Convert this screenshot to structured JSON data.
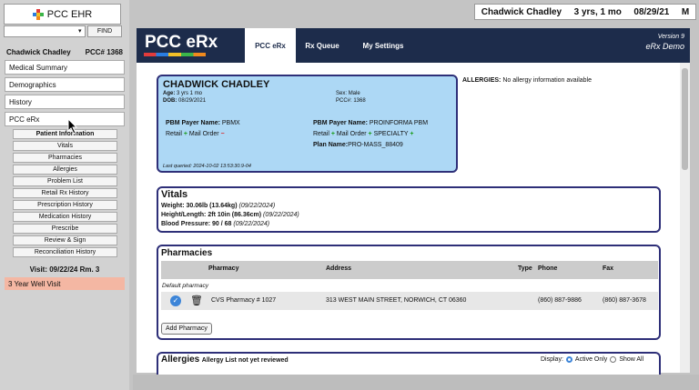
{
  "app": {
    "logo_text": "PCC EHR",
    "find_label": "FIND"
  },
  "patient_header": {
    "name": "Chadwick Chadley",
    "pcc": "PCC# 1368"
  },
  "top_header": {
    "name": "Chadwick Chadley",
    "age": "3 yrs, 1 mo",
    "dob": "08/29/21",
    "sex": "M"
  },
  "left_menu": [
    "Medical Summary",
    "Demographics",
    "History",
    "PCC eRx"
  ],
  "sub_menu": [
    "Patient Information",
    "Vitals",
    "Pharmacies",
    "Allergies",
    "Problem List",
    "Retail Rx History",
    "Prescription History",
    "Medication History",
    "Prescribe",
    "Review & Sign",
    "Reconciliation History"
  ],
  "visit": {
    "line": "Visit: 09/22/24   Rm. 3",
    "label": "3 Year Well Visit"
  },
  "erx": {
    "logo": "PCC eRx",
    "tabs": [
      "PCC eRx",
      "Rx Queue",
      "My Settings"
    ],
    "version": "Version 9",
    "demo": "eRx Demo"
  },
  "patient_card": {
    "name": "CHADWICK CHADLEY",
    "age_label": "Age:",
    "age": "3 yrs 1 mo",
    "dob_label": "DOB:",
    "dob": "08/29/2021",
    "sex_label": "Sex:",
    "sex": "Male",
    "pcc_label": "PCC#:",
    "pcc": "1368",
    "pbm1_label": "PBM Payer Name:",
    "pbm1": "PBMX",
    "pbm1_retail": "Retail",
    "pbm1_mail": "Mail Order",
    "pbm2_label": "PBM Payer Name:",
    "pbm2": "PROINFORMA PBM",
    "pbm2_retail": "Retail",
    "pbm2_mail": "Mail Order",
    "pbm2_specialty": "SPECIALTY",
    "plan_label": "Plan Name:",
    "plan": "PRO-MASS_88409",
    "last_queried": "Last queried: 2024-10-02 13:53:30.9-04"
  },
  "allergies_note": {
    "label": "ALLERGIES:",
    "text": "No allergy information available"
  },
  "vitals": {
    "title": "Vitals",
    "rows": [
      {
        "label": "Weight:",
        "value": "30.06lb (13.64kg)",
        "date": "(09/22/2024)"
      },
      {
        "label": "Height/Length:",
        "value": "2ft 10in (86.36cm)",
        "date": "(09/22/2024)"
      },
      {
        "label": "Blood Pressure:",
        "value": "90 / 68",
        "date": "(09/22/2024)"
      }
    ]
  },
  "pharmacies": {
    "title": "Pharmacies",
    "columns": [
      "Pharmacy",
      "Address",
      "Type",
      "Phone",
      "Fax"
    ],
    "default_label": "Default pharmacy",
    "rows": [
      {
        "name": "CVS Pharmacy # 1027",
        "address": "313 WEST MAIN STREET, NORWICH, CT 06360",
        "type": "",
        "phone": "(860) 887-9886",
        "fax": "(860) 887-3678"
      }
    ],
    "add_button": "Add Pharmacy"
  },
  "allergies": {
    "title": "Allergies",
    "subtitle": "Allergy List not yet reviewed",
    "display_label": "Display:",
    "opt_active": "Active Only",
    "opt_all": "Show All"
  },
  "colors": {
    "navy": "#1d2c4b",
    "card_blue": "#add8f5",
    "border": "#2e2f78",
    "visit": "#f4b7a3"
  }
}
